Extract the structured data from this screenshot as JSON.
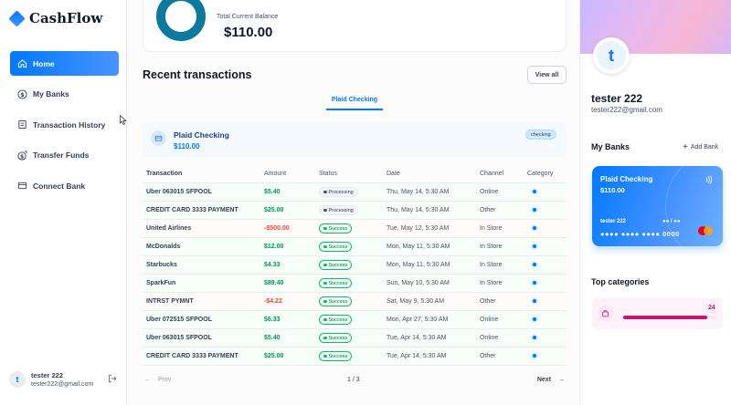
{
  "app": {
    "name": "CashFlow"
  },
  "sidebar": {
    "items": [
      {
        "label": "Home",
        "icon": "home-icon",
        "active": true
      },
      {
        "label": "My Banks",
        "icon": "dollar-circle-icon"
      },
      {
        "label": "Transaction History",
        "icon": "receipt-icon"
      },
      {
        "label": "Transfer Funds",
        "icon": "money-send-icon"
      },
      {
        "label": "Connect Bank",
        "icon": "connect-bank-icon"
      }
    ],
    "user": {
      "initial": "t",
      "name": "tester 222",
      "email": "tester222@gmail.com"
    }
  },
  "main": {
    "balance": {
      "label": "Total Current Balance",
      "value": "$110.00"
    },
    "recent_title": "Recent transactions",
    "view_all": "View all",
    "tab": "Plaid Checking",
    "account": {
      "name": "Plaid Checking",
      "amount": "$110.00",
      "badge": "checking"
    },
    "table": {
      "headers": [
        "Transaction",
        "Amount",
        "Status",
        "Date",
        "Channel",
        "Category"
      ],
      "rows": [
        {
          "name": "Uber 063015 SFPOOL",
          "amount": "$5.40",
          "type": "credit",
          "status": "Processing",
          "date": "Thu, May 14, 5:30 AM",
          "channel": "Online"
        },
        {
          "name": "CREDIT CARD 3333 PAYMENT",
          "amount": "$25.00",
          "type": "credit",
          "status": "Processing",
          "date": "Thu, May 14, 5:30 AM",
          "channel": "Other"
        },
        {
          "name": "United Airlines",
          "amount": "-$500.00",
          "type": "debit",
          "status": "Success",
          "date": "Tue, May 12, 5:30 AM",
          "channel": "In Store"
        },
        {
          "name": "McDonalds",
          "amount": "$12.00",
          "type": "credit",
          "status": "Success",
          "date": "Mon, May 11, 5:30 AM",
          "channel": "In Store"
        },
        {
          "name": "Starbucks",
          "amount": "$4.33",
          "type": "credit",
          "status": "Success",
          "date": "Mon, May 11, 5:30 AM",
          "channel": "In Store"
        },
        {
          "name": "SparkFun",
          "amount": "$89.40",
          "type": "credit",
          "status": "Success",
          "date": "Sun, May 10, 5:30 AM",
          "channel": "In Store"
        },
        {
          "name": "INTRST PYMNT",
          "amount": "-$4.22",
          "type": "debit",
          "status": "Success",
          "date": "Sat, May 9, 5:30 AM",
          "channel": "Other"
        },
        {
          "name": "Uber 072515 SFPOOL",
          "amount": "$6.33",
          "type": "credit",
          "status": "Success",
          "date": "Mon, Apr 27, 5:30 AM",
          "channel": "Online"
        },
        {
          "name": "Uber 063015 SFPOOL",
          "amount": "$5.40",
          "type": "credit",
          "status": "Success",
          "date": "Tue, Apr 14, 5:30 AM",
          "channel": "Online"
        },
        {
          "name": "CREDIT CARD 3333 PAYMENT",
          "amount": "$25.00",
          "type": "credit",
          "status": "Success",
          "date": "Tue, Apr 14, 5:30 AM",
          "channel": "Other"
        }
      ]
    },
    "pagination": {
      "prev": "Prev",
      "page": "1 / 3",
      "next": "Next"
    }
  },
  "right": {
    "profile": {
      "initial": "t",
      "name": "tester 222",
      "email": "tester222@gmail.com"
    },
    "my_banks_title": "My Banks",
    "add_bank": "Add Bank",
    "card": {
      "bank": "Plaid Checking",
      "amount": "$110.00",
      "holder": "tester 222",
      "expiry": "●● / ●●",
      "number": "●●●● ●●●● ●●●● 0000"
    },
    "top_categories_title": "Top categories",
    "category": {
      "count": "24",
      "fill_fraction": 0.9,
      "icon": "shopping-bag-icon"
    }
  },
  "colors": {
    "accent": "#0179FE",
    "credit": "#039855",
    "debit": "#F04438",
    "category": "#C11574"
  }
}
